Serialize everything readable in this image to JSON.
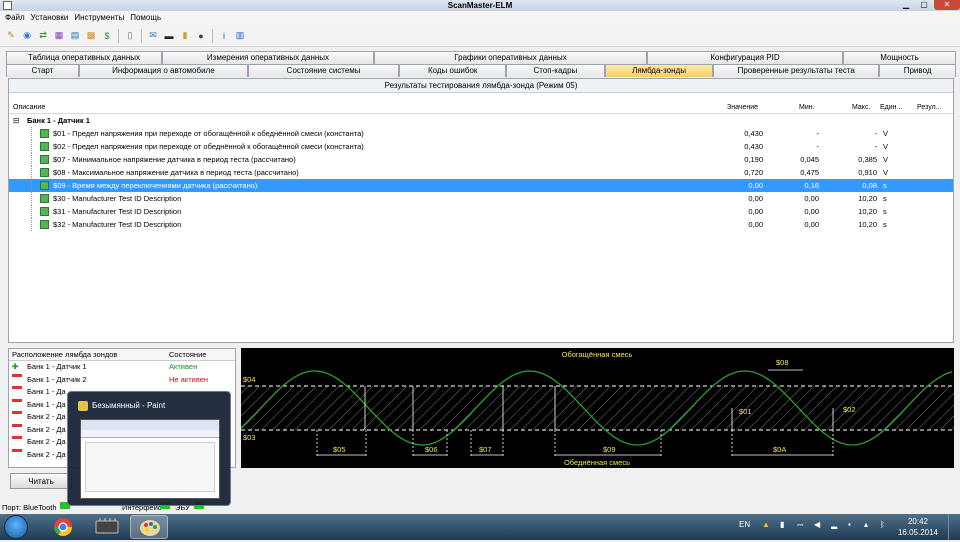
{
  "window": {
    "title": "ScanMaster-ELM"
  },
  "menu": [
    "Файл",
    "Установки",
    "Инструменты",
    "Помощь"
  ],
  "toolbar_icons": [
    "wrench-icon",
    "globe-icon",
    "connect-icon",
    "chart-icon",
    "report-icon",
    "grid-icon",
    "dollar-icon",
    "sep",
    "document-icon",
    "sep",
    "chat-icon",
    "terminal-icon",
    "battery-icon",
    "stop-icon",
    "sep",
    "info-icon",
    "book-icon"
  ],
  "tabs_row1": [
    {
      "label": "Таблица оперативных данных",
      "w": 156
    },
    {
      "label": "Измерения оперативных данных",
      "w": 212
    },
    {
      "label": "Графики оперативных данных",
      "w": 273
    },
    {
      "label": "Конфигурация PID",
      "w": 196
    },
    {
      "label": "Мощность",
      "w": 113
    }
  ],
  "tabs_row2": [
    {
      "label": "Старт",
      "w": 76
    },
    {
      "label": "Информация о автомобиле",
      "w": 176
    },
    {
      "label": "Состояние системы",
      "w": 158
    },
    {
      "label": "Коды ошибок",
      "w": 111
    },
    {
      "label": "Стоп-кадры",
      "w": 103
    },
    {
      "label": "Лямбда-зонды",
      "w": 113,
      "active": true
    },
    {
      "label": "Проверенные результаты теста",
      "w": 173
    },
    {
      "label": "Привод",
      "w": 80
    }
  ],
  "results": {
    "caption": "Результаты тестирования лямбда-зонда (Режим 05)",
    "columns": {
      "desc": "Описание",
      "value": "Значение",
      "min": "Мин.",
      "max": "Макс.",
      "unit": "Един...",
      "result": "Резул..."
    },
    "group": "Банк 1 - Датчик 1",
    "rows": [
      {
        "desc": "$01 - Предел напряжения при переходе от обогащённой к обеднённой смеси (константа)",
        "value": "0,430",
        "min": "-",
        "max": "-",
        "unit": "V"
      },
      {
        "desc": "$02 - Предел напряжения при переходе от обеднённой к обогащённой смеси (константа)",
        "value": "0,430",
        "min": "-",
        "max": "-",
        "unit": "V"
      },
      {
        "desc": "$07 - Минимальное напряжение датчика в период теста (рассчитано)",
        "value": "0,190",
        "min": "0,045",
        "max": "0,385",
        "unit": "V"
      },
      {
        "desc": "$08 - Максимальное напряжение датчика в период теста (рассчитано)",
        "value": "0,720",
        "min": "0,475",
        "max": "0,910",
        "unit": "V"
      },
      {
        "desc": "$09 - Время между переключениями датчика (рассчитано)",
        "value": "0,00",
        "min": "0,16",
        "max": "0,08",
        "unit": "s",
        "selected": true
      },
      {
        "desc": "$30 - Manufacturer Test ID Description",
        "value": "0,00",
        "min": "0,00",
        "max": "10,20",
        "unit": "s"
      },
      {
        "desc": "$31 - Manufacturer Test ID Description",
        "value": "0,00",
        "min": "0,00",
        "max": "10,20",
        "unit": "s"
      },
      {
        "desc": "$32 - Manufacturer Test ID Description",
        "value": "0,00",
        "min": "0,00",
        "max": "10,20",
        "unit": "s"
      }
    ]
  },
  "sensors": {
    "col_location": "Расположение лямбда зондов",
    "col_state": "Состояние",
    "items": [
      {
        "name": "Банк 1 - Датчик 1",
        "state": "Активен",
        "active": true
      },
      {
        "name": "Банк 1 - Датчик 2",
        "state": "Не активен",
        "active": false
      },
      {
        "name": "Банк 1 - Да",
        "state": "",
        "active": false
      },
      {
        "name": "Банк 1 - Да",
        "state": "",
        "active": false
      },
      {
        "name": "Банк 2 - Да",
        "state": "",
        "active": false
      },
      {
        "name": "Банк 2 - Да",
        "state": "",
        "active": false
      },
      {
        "name": "Банк 2 - Да",
        "state": "",
        "active": false
      },
      {
        "name": "Банк 2 - Да",
        "state": "",
        "active": false
      }
    ],
    "read_button": "Читать"
  },
  "graph": {
    "rich": "Обогащённая смесь",
    "lean": "Обеднённая смесь",
    "labels": {
      "l04": "$04",
      "l03": "$03",
      "l01": "$01",
      "l02": "$02",
      "l08": "$08",
      "l05": "$05",
      "l06": "$06",
      "l07": "$07",
      "l09": "$09",
      "l0A": "$0A"
    },
    "colors": {
      "wave": "#2f9e2f",
      "text": "#f2e35c",
      "lines": "#ffffff"
    }
  },
  "status": {
    "port": "Порт: BlueTooth",
    "interface": "Интерфейс",
    "ecu": "ЭБУ"
  },
  "preview": {
    "title": "Безымянный - Paint"
  },
  "taskbar": {
    "lang": "EN",
    "time": "20:42",
    "date": "16.05.2014"
  }
}
